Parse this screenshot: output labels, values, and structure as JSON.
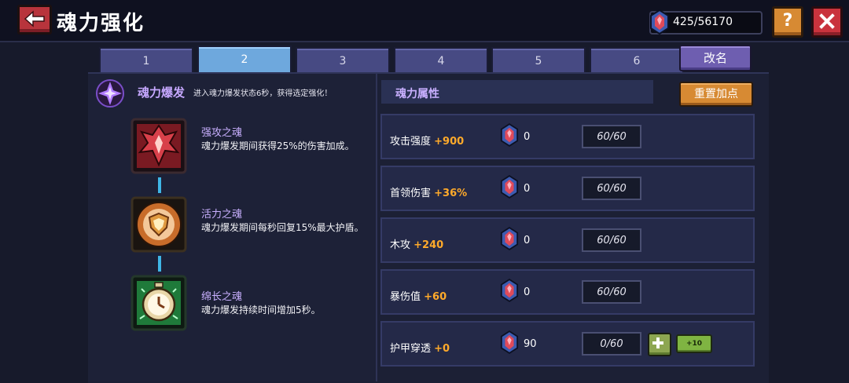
{
  "header": {
    "title": "魂力强化",
    "currency_value": "425/56170",
    "help_label": "?"
  },
  "tabs": [
    {
      "label": "1",
      "active": false
    },
    {
      "label": "2",
      "active": true
    },
    {
      "label": "3",
      "active": false
    },
    {
      "label": "4",
      "active": false
    },
    {
      "label": "5",
      "active": false
    },
    {
      "label": "6",
      "active": false
    }
  ],
  "rename_label": "改名",
  "burst": {
    "title": "魂力爆发",
    "description": "进入魂力爆发状态6秒，获得选定强化！"
  },
  "souls": [
    {
      "name": "强攻之魂",
      "desc": "魂力爆发期间获得25%的伤害加成。",
      "icon": "red-claw-icon"
    },
    {
      "name": "活力之魂",
      "desc": "魂力爆发期间每秒回复15%最大护盾。",
      "icon": "shield-badge-icon"
    },
    {
      "name": "绵长之魂",
      "desc": "魂力爆发持续时间增加5秒。",
      "icon": "stopwatch-icon"
    }
  ],
  "attributes": {
    "header": "魂力属性",
    "reset_label": "重置加点",
    "rows": [
      {
        "name": "攻击强度",
        "bonus": "+900",
        "cost": "0",
        "level": "60/60",
        "can_upgrade": false
      },
      {
        "name": "首领伤害",
        "bonus": "+36%",
        "cost": "0",
        "level": "60/60",
        "can_upgrade": false
      },
      {
        "name": "木攻",
        "bonus": "+240",
        "cost": "0",
        "level": "60/60",
        "can_upgrade": false
      },
      {
        "name": "暴伤值",
        "bonus": "+60",
        "cost": "0",
        "level": "60/60",
        "can_upgrade": false
      },
      {
        "name": "护甲穿透",
        "bonus": "+0",
        "cost": "90",
        "level": "0/60",
        "can_upgrade": true,
        "plus10_label": "+10"
      }
    ]
  },
  "colors": {
    "accent_orange": "#d78a33",
    "bonus_orange": "#ffaa2a",
    "tab_active": "#6ea8dd",
    "tab_inactive": "#474a83",
    "close_red": "#c9333d",
    "plus_green": "#7fb442",
    "label_purple": "#c9b0ff"
  }
}
